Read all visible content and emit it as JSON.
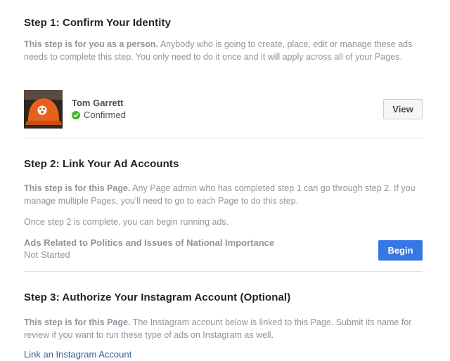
{
  "step1": {
    "heading": "Step 1: Confirm Your Identity",
    "intro_bold": "This step is for you as a person.",
    "intro_text": " Anybody who is going to create, place, edit or manage these ads needs to complete this step. You only need to do it once and it will apply across all of your Pages.",
    "user_name": "Tom Garrett",
    "status": "Confirmed",
    "view_label": "View"
  },
  "step2": {
    "heading": "Step 2: Link Your Ad Accounts",
    "intro_bold": "This step is for this Page.",
    "intro_text": " Any Page admin who has completed step 1 can go through step 2. If you manage multiple Pages, you'll need to go to each Page to do this step.",
    "note": "Once step 2 is complete, you can begin running ads.",
    "ads_title": "Ads Related to Politics and Issues of National Importance",
    "ads_status": "Not Started",
    "begin_label": "Begin"
  },
  "step3": {
    "heading": "Step 3: Authorize Your Instagram Account (Optional)",
    "intro_bold": "This step is for this Page.",
    "intro_text": " The Instagram account below is linked to this Page. Submit its name for review if you want to run these type of ads on Instagram as well.",
    "link_label": "Link an Instagram Account"
  },
  "colors": {
    "begin_button": "#3578e5",
    "confirmed_check": "#42b72a",
    "link": "#365899"
  }
}
